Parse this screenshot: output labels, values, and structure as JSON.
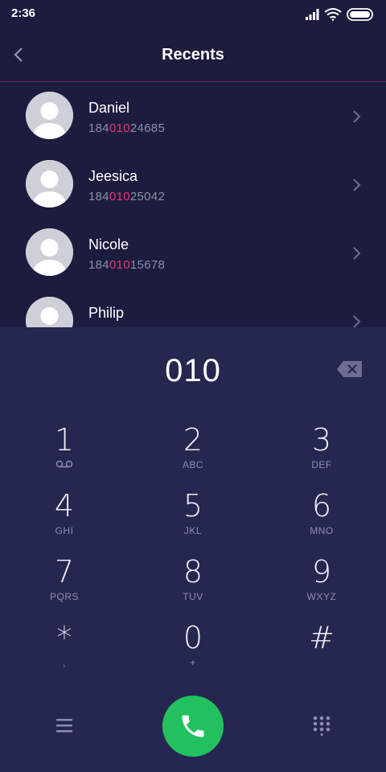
{
  "status_bar": {
    "time": "2:36"
  },
  "header": {
    "title": "Recents",
    "back_icon": "chevron-left-icon"
  },
  "contacts": [
    {
      "name": "Daniel",
      "number_pre": "184",
      "number_match": "010",
      "number_post": "24685"
    },
    {
      "name": "Jeesica",
      "number_pre": "184",
      "number_match": "010",
      "number_post": "25042"
    },
    {
      "name": "Nicole",
      "number_pre": "184",
      "number_match": "010",
      "number_post": "15678"
    },
    {
      "name": "Philip",
      "number_pre": "",
      "number_match": "",
      "number_post": ""
    }
  ],
  "dialer": {
    "input_value": "010",
    "keys": [
      {
        "digit": "1",
        "letters": ""
      },
      {
        "digit": "2",
        "letters": "ABC"
      },
      {
        "digit": "3",
        "letters": "DEF"
      },
      {
        "digit": "4",
        "letters": "GHI"
      },
      {
        "digit": "5",
        "letters": "JKL"
      },
      {
        "digit": "6",
        "letters": "MNO"
      },
      {
        "digit": "7",
        "letters": "PQRS"
      },
      {
        "digit": "8",
        "letters": "TUV"
      },
      {
        "digit": "9",
        "letters": "WXYZ"
      },
      {
        "digit": "*",
        "letters": ","
      },
      {
        "digit": "0",
        "letters": "+"
      },
      {
        "digit": "#",
        "letters": ""
      }
    ]
  },
  "colors": {
    "background": "#1c1c3e",
    "dialer_background": "#262750",
    "highlight": "#e8386d",
    "call_button": "#22c15e",
    "secondary_text": "#8e8ea8"
  }
}
